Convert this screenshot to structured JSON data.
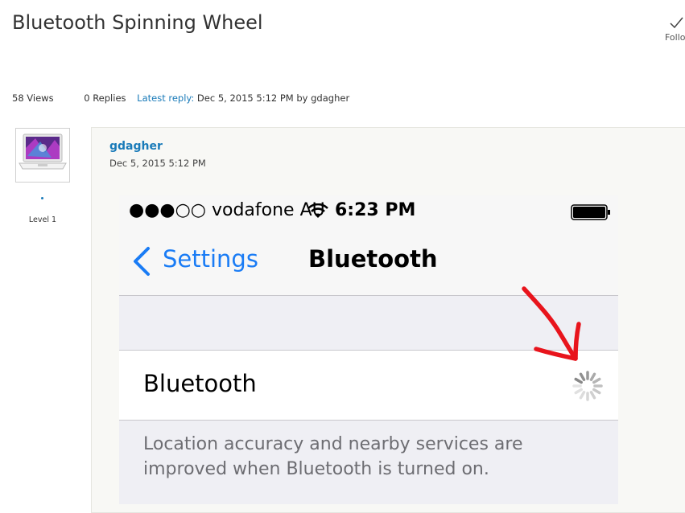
{
  "thread": {
    "title": "Bluetooth Spinning Wheel",
    "follow_label": "Follo",
    "views": "58 Views",
    "replies": "0 Replies",
    "latest_reply_label": "Latest reply:",
    "latest_reply_text": "Dec 5, 2015 5:12 PM by gdagher"
  },
  "author": {
    "level": "Level 1",
    "name": "gdagher",
    "date": "Dec 5, 2015 5:12 PM"
  },
  "screenshot": {
    "carrier": "●●●○○ vodafone AU",
    "time": "6:23 PM",
    "back_label": "Settings",
    "nav_title": "Bluetooth",
    "row_label": "Bluetooth",
    "footnote_line1": "Location accuracy and nearby services are",
    "footnote_line2": "improved when Bluetooth is turned on.",
    "accent_color": "#1a7cf5",
    "annotation_color": "#e8141c"
  },
  "colors": {
    "link": "#1a7bb9",
    "text": "#333333"
  }
}
